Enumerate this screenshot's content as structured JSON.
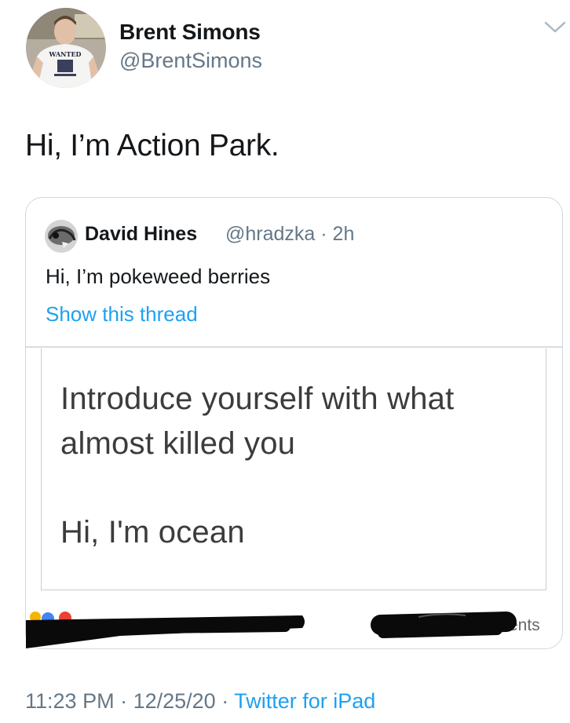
{
  "author": {
    "display_name": "Brent Simons",
    "handle": "@BrentSimons",
    "avatar_text": "WANTED"
  },
  "tweet": {
    "text": "Hi, I’m Action Park."
  },
  "quoted_tweet": {
    "display_name": "David Hines",
    "handle_time": "@hradzka · 2h",
    "text": "Hi, I’m pokeweed berries",
    "show_thread": "Show this thread",
    "image": {
      "prompt_line_1": "Introduce yourself with what",
      "prompt_line_2": "almost killed you",
      "reply": "Hi, I'm ocean",
      "comments_fragment": "ents"
    }
  },
  "footer": {
    "time": "11:23 PM",
    "date": "12/25/20",
    "separator": " · ",
    "via": "Twitter for iPad"
  },
  "icons": {
    "more": "chevron-down-icon"
  },
  "colors": {
    "link": "#1da1f2",
    "secondary_text": "#657786",
    "border": "#cfd9de"
  }
}
